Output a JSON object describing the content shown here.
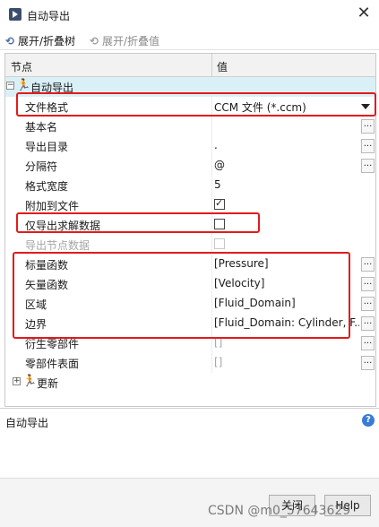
{
  "window": {
    "title": "自动导出",
    "close_glyph": "✕"
  },
  "toolbar": {
    "expand_tree": "展开/折叠树",
    "expand_values": "展开/折叠值"
  },
  "grid": {
    "header_node": "节点",
    "header_value": "值",
    "group_auto_export": "自动导出",
    "rows": [
      {
        "label": "文件格式",
        "value": "CCM 文件 (*.ccm)"
      },
      {
        "label": "基本名",
        "value": ""
      },
      {
        "label": "导出目录",
        "value": "."
      },
      {
        "label": "分隔符",
        "value": "@"
      },
      {
        "label": "格式宽度",
        "value": "5"
      },
      {
        "label": "附加到文件",
        "value": ""
      },
      {
        "label": "仅导出求解数据",
        "value": ""
      },
      {
        "label": "导出节点数据",
        "value": ""
      },
      {
        "label": "标量函数",
        "value": "[Pressure]"
      },
      {
        "label": "矢量函数",
        "value": "[Velocity]"
      },
      {
        "label": "区域",
        "value": "[Fluid_Domain]"
      },
      {
        "label": "边界",
        "value": "[Fluid_Domain: Cylinder, F..."
      },
      {
        "label": "衍生零部件",
        "value": "[]"
      },
      {
        "label": "零部件表面",
        "value": "[]"
      }
    ],
    "group_update": "更新"
  },
  "description": {
    "title": "自动导出"
  },
  "footer": {
    "close_label": "关闭",
    "help_label": "Help"
  },
  "watermark": "CSDN @m0_57643629"
}
